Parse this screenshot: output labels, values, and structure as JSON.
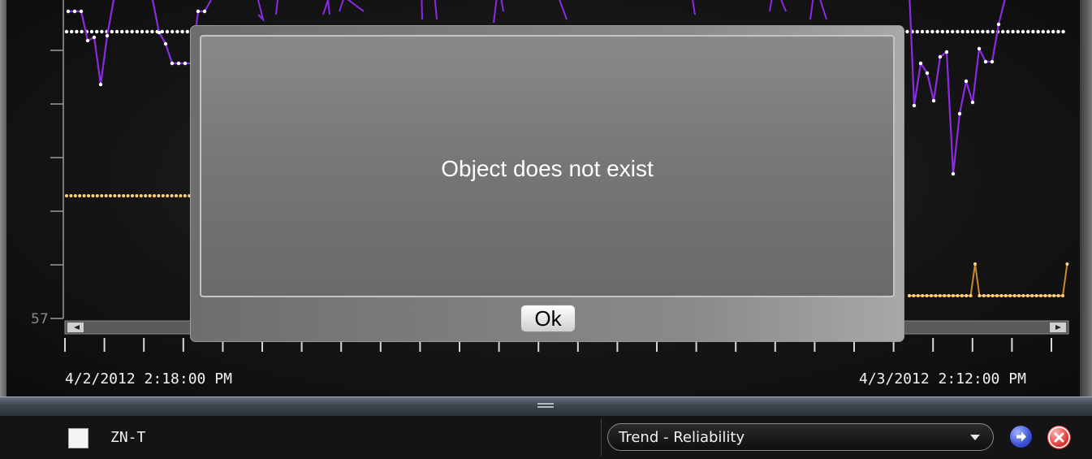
{
  "chart": {
    "y_axis": {
      "visible_tick_labels": [
        "57"
      ]
    },
    "x_axis": {
      "start_label": "4/2/2012 2:18:00 PM",
      "end_label": "4/3/2012 2:12:00 PM"
    },
    "series": [
      {
        "color": "#ffffff",
        "marker": "dot",
        "kind": "flat-reference"
      },
      {
        "color": "#ffd27a",
        "marker": "dot",
        "kind": "flat-reference"
      },
      {
        "color": "#8a2be2",
        "marker": "dot",
        "kind": "trend"
      },
      {
        "color": "#c88a2a",
        "marker": "dot",
        "kind": "trend"
      }
    ],
    "scrollbar": {
      "left_icon": "scroll-left-icon",
      "right_icon": "scroll-right-icon"
    }
  },
  "footer": {
    "point_name": "ZN-T",
    "view_select": {
      "selected": "Trend - Reliability"
    },
    "go_icon": "arrow-right-icon",
    "remove_icon": "close-icon"
  },
  "dialog": {
    "message": "Object does not exist",
    "ok_label": "Ok"
  }
}
